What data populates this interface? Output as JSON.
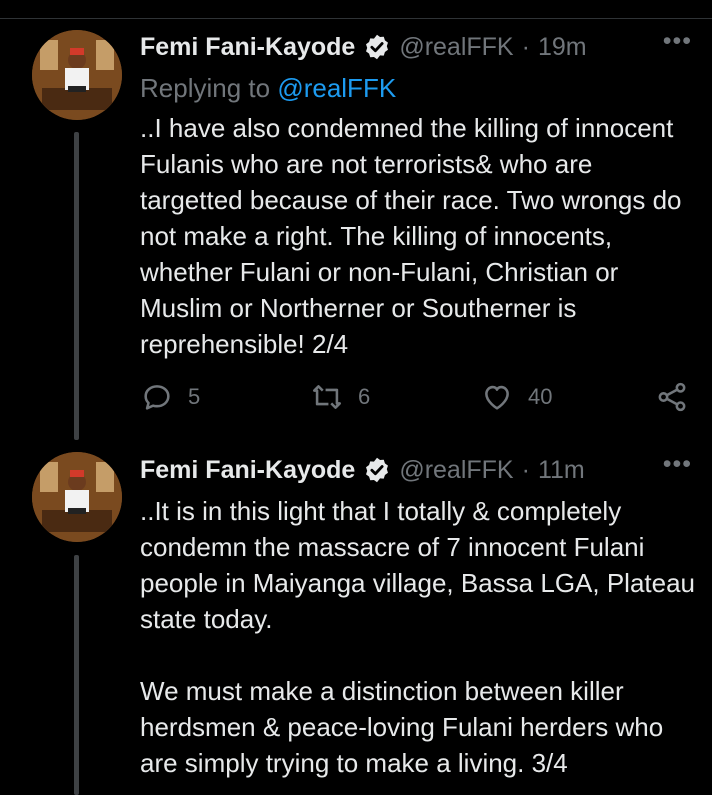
{
  "colors": {
    "background": "#000000",
    "text": "#e7e9ea",
    "muted": "#71767b",
    "accent": "#1d9bf0"
  },
  "tweets": [
    {
      "author_name": "Femi Fani-Kayode",
      "handle": "@realFFK",
      "separator": "·",
      "time": "19m",
      "more_icon": "more-horizontal-icon",
      "replying_prefix": "Replying to",
      "replying_to": "@realFFK",
      "text": "..I have also condemned the killing of innocent Fulanis who are not terrorists& who are targetted because of their race. Two wrongs do not make a right. The killing of innocents, whether Fulani or non-Fulani, Christian or Muslim or Northerner or Southerner is reprehensible! 2/4",
      "replies": "5",
      "retweets": "6",
      "likes": "40"
    },
    {
      "author_name": "Femi Fani-Kayode",
      "handle": "@realFFK",
      "separator": "·",
      "time": "11m",
      "more_icon": "more-horizontal-icon",
      "text": "..It is in this light that I totally & completely condemn the massacre of 7 innocent Fulani people in Maiyanga village, Bassa LGA, Plateau state today.\n\nWe must make a distinction between killer herdsmen & peace-loving Fulani herders who are simply trying to make a living. 3/4"
    }
  ]
}
